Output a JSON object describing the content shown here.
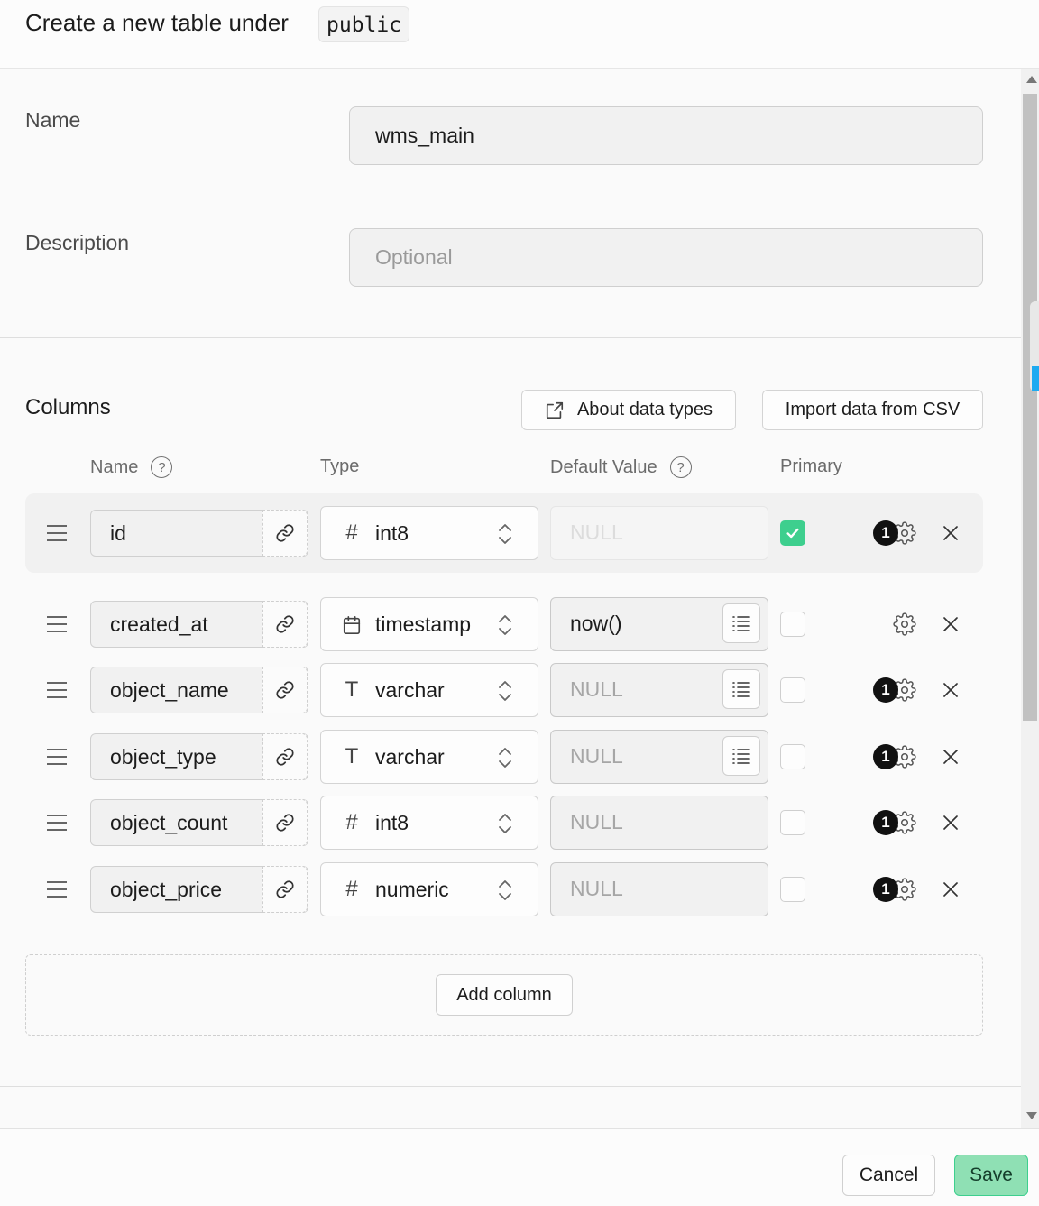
{
  "header": {
    "title": "Create a new table under",
    "schema": "public"
  },
  "form": {
    "name_label": "Name",
    "name_value": "wms_main",
    "description_label": "Description",
    "description_placeholder": "Optional"
  },
  "columns_section": {
    "title": "Columns",
    "about_button": "About data types",
    "import_button": "Import data from CSV",
    "headers": {
      "name": "Name",
      "type": "Type",
      "default": "Default Value",
      "primary": "Primary"
    },
    "rows": [
      {
        "name": "id",
        "type_icon": "#",
        "type": "int8",
        "default": "NULL",
        "default_is_value": false,
        "primary": true,
        "badge": "1",
        "has_list_button": false
      },
      {
        "name": "created_at",
        "type_icon": "calendar-icon",
        "type": "timestamp",
        "default": "now()",
        "default_is_value": true,
        "primary": false,
        "badge": "",
        "has_list_button": true
      },
      {
        "name": "object_name",
        "type_icon": "T",
        "type": "varchar",
        "default": "NULL",
        "default_is_value": false,
        "primary": false,
        "badge": "1",
        "has_list_button": true
      },
      {
        "name": "object_type",
        "type_icon": "T",
        "type": "varchar",
        "default": "NULL",
        "default_is_value": false,
        "primary": false,
        "badge": "1",
        "has_list_button": true
      },
      {
        "name": "object_count",
        "type_icon": "#",
        "type": "int8",
        "default": "NULL",
        "default_is_value": false,
        "primary": false,
        "badge": "1",
        "has_list_button": false
      },
      {
        "name": "object_price",
        "type_icon": "#",
        "type": "numeric",
        "default": "NULL",
        "default_is_value": false,
        "primary": false,
        "badge": "1",
        "has_list_button": false
      }
    ],
    "add_column_button": "Add column"
  },
  "footer": {
    "cancel_label": "Cancel",
    "save_label": "Save"
  },
  "colors": {
    "accent": "#3ecf8e",
    "save_bg": "#8fe0b4",
    "scroll_marker": "#1eaaf1"
  }
}
